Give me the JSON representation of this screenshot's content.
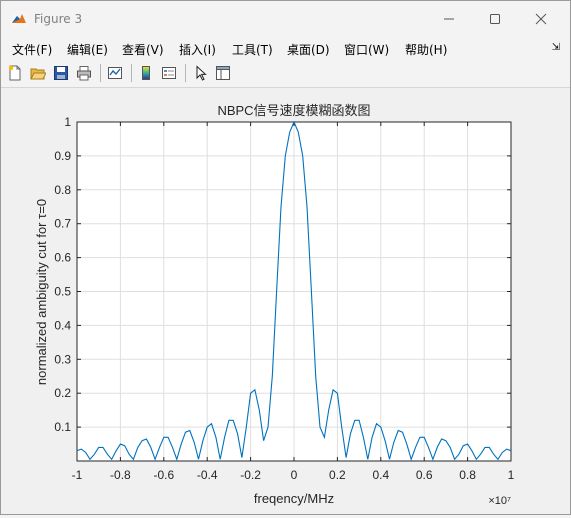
{
  "window": {
    "title": "Figure 3",
    "controls": [
      "minimize",
      "maximize",
      "close"
    ]
  },
  "menu": [
    "文件(F)",
    "编辑(E)",
    "查看(V)",
    "插入(I)",
    "工具(T)",
    "桌面(D)",
    "窗口(W)",
    "帮助(H)"
  ],
  "toolbar": [
    "new-figure",
    "open-file",
    "save",
    "print",
    "link-plot",
    "insert-colorbar",
    "insert-legend",
    "edit-plot",
    "property-inspector"
  ],
  "chart_data": {
    "type": "line",
    "title": "NBPC信号速度模糊函数图",
    "xlabel": "freqency/MHz",
    "ylabel": "normalized ambiguity cut for τ=0",
    "x_exponent_label": "×10⁷",
    "xlim": [
      -1,
      1
    ],
    "ylim": [
      0,
      1
    ],
    "x_ticks": [
      "-1",
      "-0.8",
      "-0.6",
      "-0.4",
      "-0.2",
      "0",
      "0.2",
      "0.4",
      "0.6",
      "0.8",
      "1"
    ],
    "y_ticks": [
      "0.1",
      "0.2",
      "0.3",
      "0.4",
      "0.5",
      "0.6",
      "0.7",
      "0.8",
      "0.9",
      "1"
    ],
    "grid": true,
    "color": "#0072bd",
    "x": [
      -1,
      -0.98,
      -0.96,
      -0.94,
      -0.92,
      -0.9,
      -0.88,
      -0.86,
      -0.84,
      -0.82,
      -0.8,
      -0.78,
      -0.76,
      -0.74,
      -0.72,
      -0.7,
      -0.68,
      -0.66,
      -0.64,
      -0.62,
      -0.6,
      -0.58,
      -0.56,
      -0.54,
      -0.52,
      -0.5,
      -0.48,
      -0.46,
      -0.44,
      -0.42,
      -0.4,
      -0.38,
      -0.36,
      -0.34,
      -0.32,
      -0.3,
      -0.28,
      -0.26,
      -0.24,
      -0.22,
      -0.2,
      -0.18,
      -0.16,
      -0.14,
      -0.12,
      -0.1,
      -0.08,
      -0.06,
      -0.04,
      -0.02,
      0,
      0.02,
      0.04,
      0.06,
      0.08,
      0.1,
      0.12,
      0.14,
      0.16,
      0.18,
      0.2,
      0.22,
      0.24,
      0.26,
      0.28,
      0.3,
      0.32,
      0.34,
      0.36,
      0.38,
      0.4,
      0.42,
      0.44,
      0.46,
      0.48,
      0.5,
      0.52,
      0.54,
      0.56,
      0.58,
      0.6,
      0.62,
      0.64,
      0.66,
      0.68,
      0.7,
      0.72,
      0.74,
      0.76,
      0.78,
      0.8,
      0.82,
      0.84,
      0.86,
      0.88,
      0.9,
      0.92,
      0.94,
      0.96,
      0.98,
      1
    ],
    "y": [
      0.03,
      0.035,
      0.025,
      0.005,
      0.02,
      0.04,
      0.04,
      0.02,
      0.005,
      0.03,
      0.05,
      0.045,
      0.02,
      0.005,
      0.04,
      0.06,
      0.065,
      0.04,
      0.005,
      0.04,
      0.07,
      0.07,
      0.04,
      0.005,
      0.05,
      0.085,
      0.09,
      0.055,
      0.005,
      0.06,
      0.1,
      0.11,
      0.07,
      0.005,
      0.07,
      0.12,
      0.12,
      0.08,
      0.01,
      0.1,
      0.2,
      0.21,
      0.15,
      0.06,
      0.1,
      0.25,
      0.5,
      0.75,
      0.9,
      0.97,
      1,
      0.97,
      0.9,
      0.75,
      0.5,
      0.25,
      0.1,
      0.07,
      0.15,
      0.21,
      0.2,
      0.1,
      0.01,
      0.08,
      0.12,
      0.12,
      0.07,
      0.005,
      0.07,
      0.11,
      0.1,
      0.06,
      0.005,
      0.055,
      0.09,
      0.085,
      0.05,
      0.005,
      0.04,
      0.07,
      0.07,
      0.04,
      0.005,
      0.04,
      0.065,
      0.06,
      0.04,
      0.005,
      0.02,
      0.045,
      0.05,
      0.03,
      0.005,
      0.02,
      0.04,
      0.04,
      0.02,
      0.005,
      0.025,
      0.035,
      0.03
    ]
  }
}
